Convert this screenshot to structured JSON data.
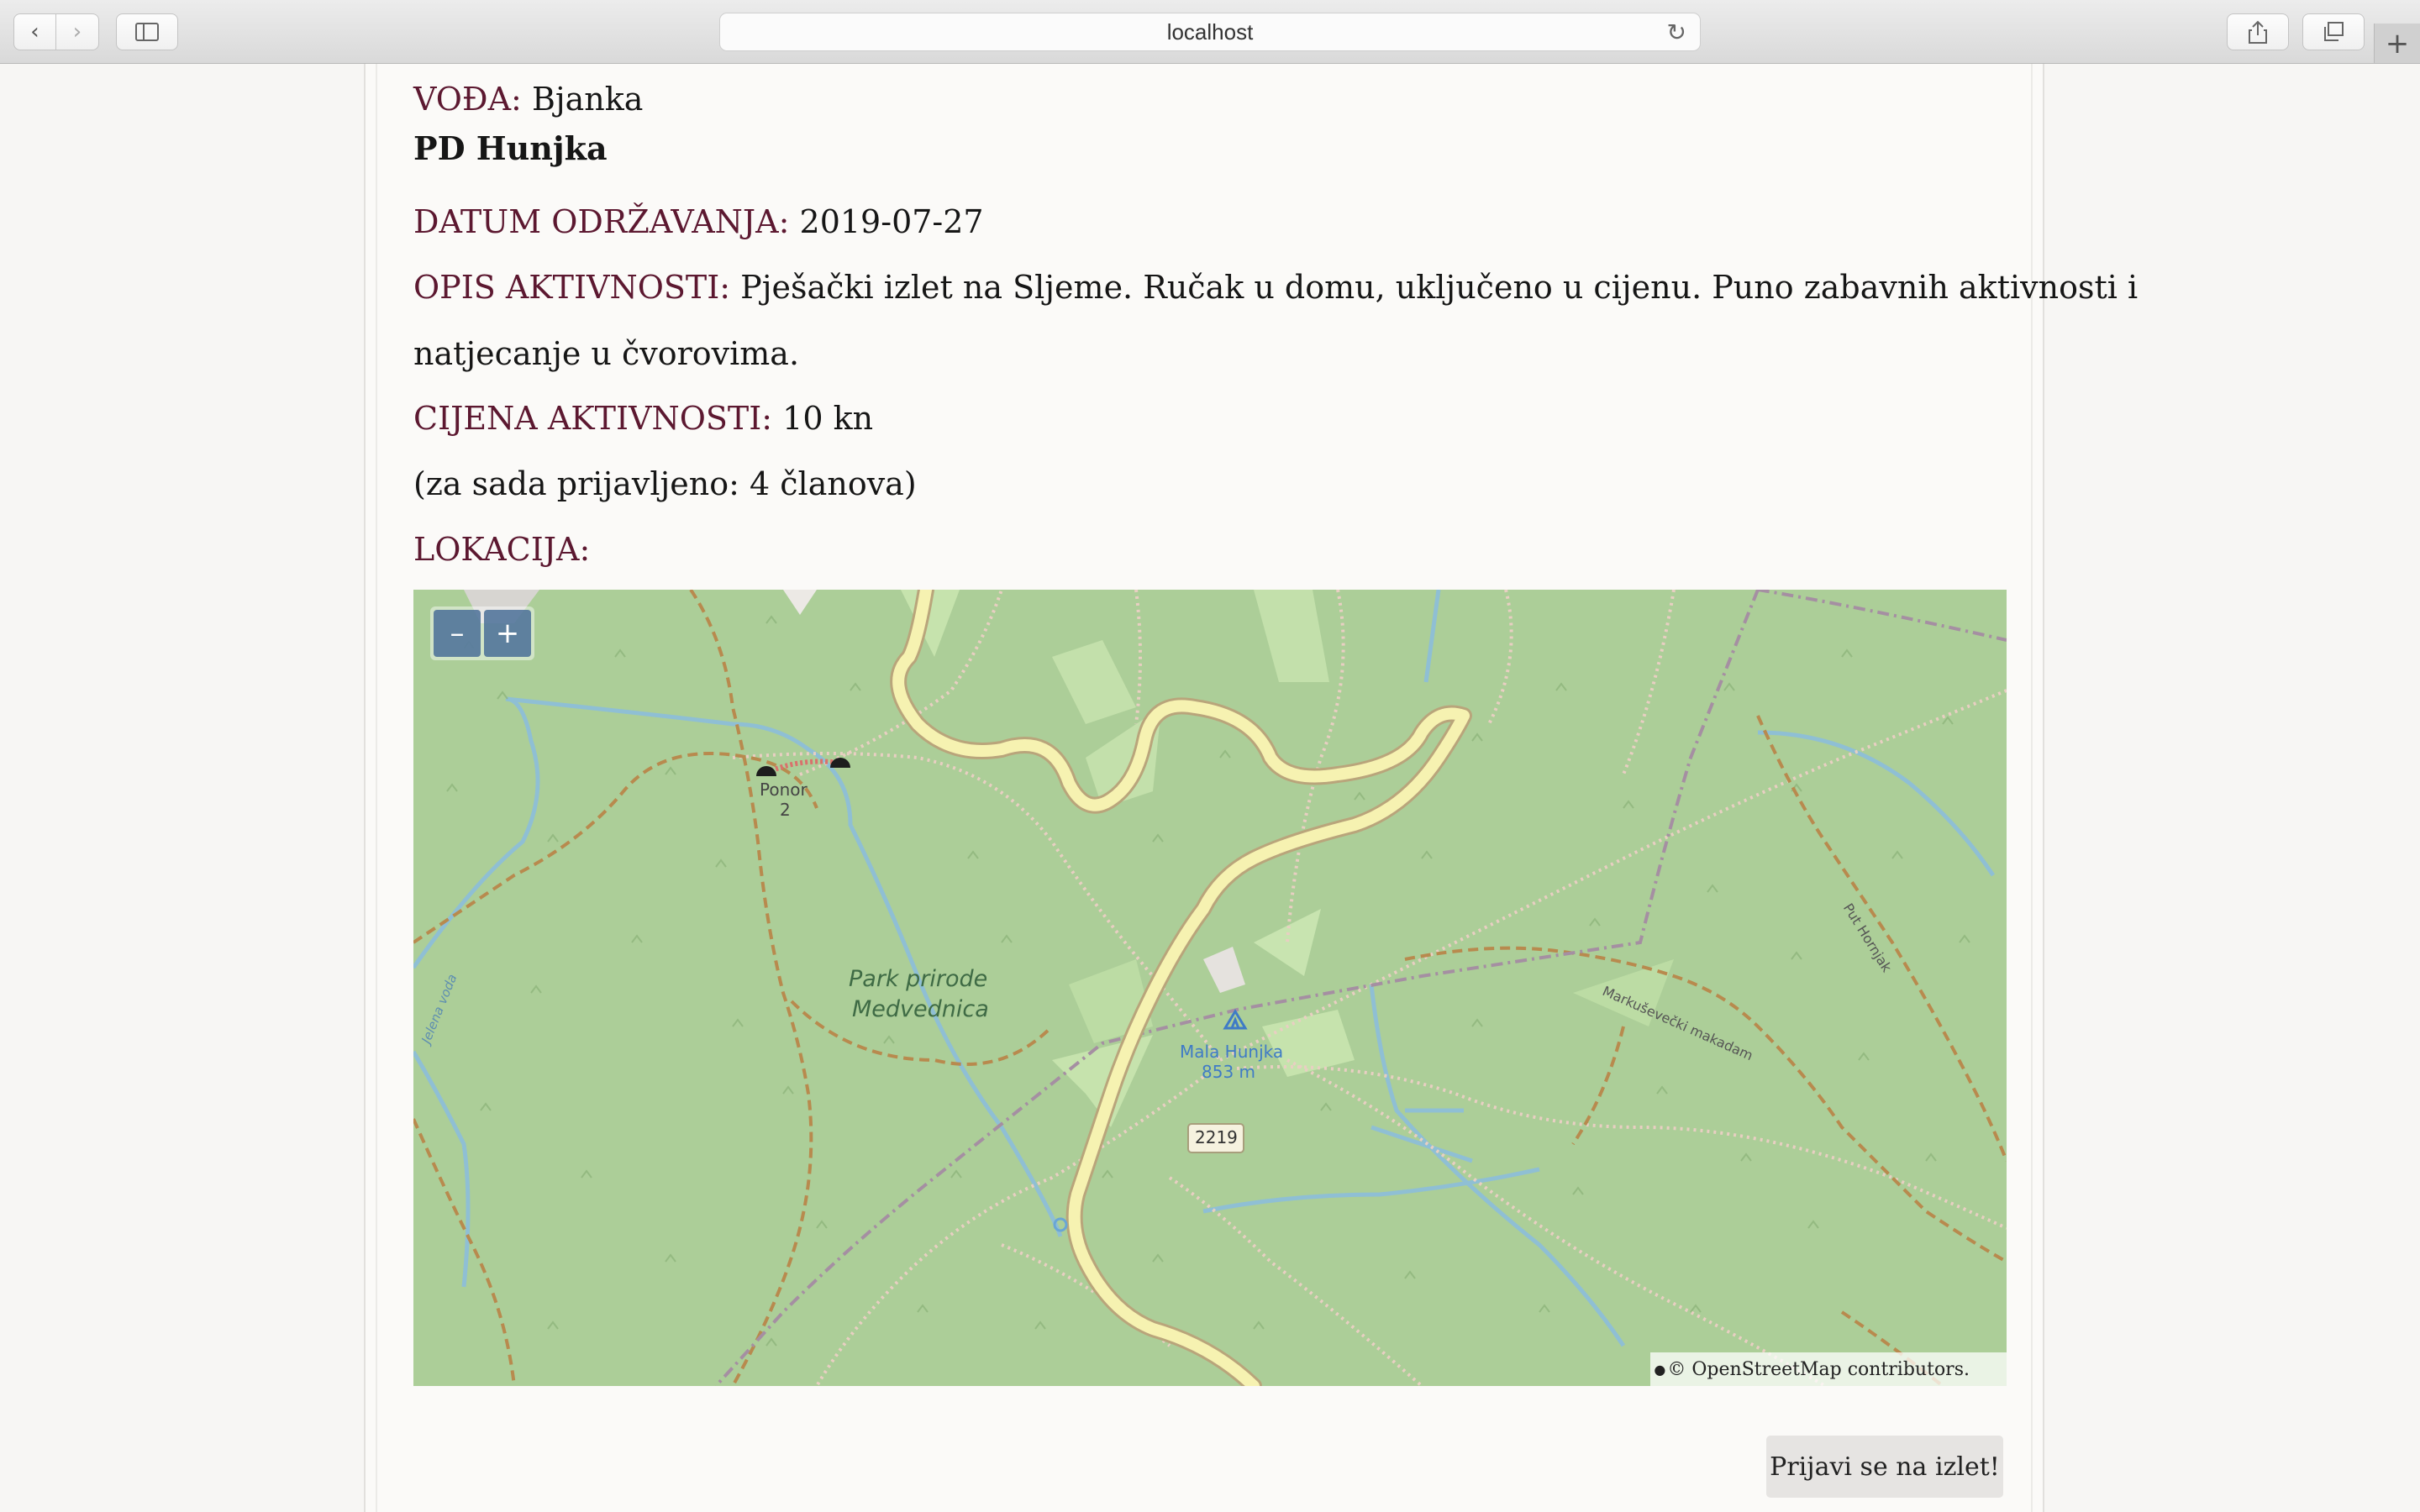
{
  "browser": {
    "url": "localhost",
    "back_icon": "chevron-left-icon",
    "forward_icon": "chevron-right-icon",
    "sidebar_icon": "sidebar-icon",
    "reload_icon": "reload-icon",
    "share_icon": "share-icon",
    "tabs_icon": "tabs-icon",
    "new_tab_icon": "plus-icon"
  },
  "activity": {
    "leader_label": "VOĐA:",
    "leader_value": "Bjanka",
    "club": "PD Hunjka",
    "date_label": "DATUM ODRŽAVANJA:",
    "date_value": "2019-07-27",
    "desc_label": "OPIS AKTIVNOSTI:",
    "desc_line1": "Pješački izlet na Sljeme. Ručak u domu, uključeno u cijenu. Puno zabavnih aktivnosti i",
    "desc_line2": "natjecanje u čvorovima.",
    "price_label": "CIJENA AKTIVNOSTI:",
    "price_value": "10 kn",
    "registered": "(za sada prijavljeno: 4 članova)",
    "location_label": "LOKACIJA:"
  },
  "map": {
    "zoom_out": "–",
    "zoom_in": "+",
    "labels": {
      "park_line1": "Park prirode",
      "park_line2": "Medvednica",
      "peak_name": "Mala Hunjka",
      "peak_elevation": "853 m",
      "ponor": "Ponor",
      "ponor_num": "2",
      "road_number": "2219",
      "street1": "Markuševečki makadam",
      "street2": "Put Hornjak",
      "stream": "Jelena voda"
    },
    "attribution": "© OpenStreetMap contributors."
  },
  "actions": {
    "register_button": "Prijavi se na izlet!"
  }
}
